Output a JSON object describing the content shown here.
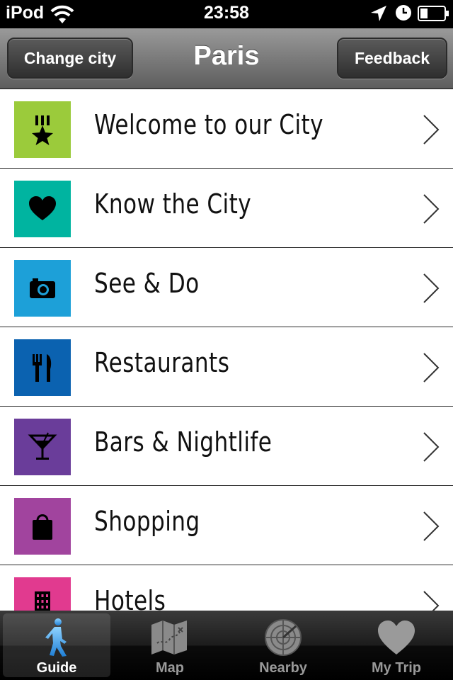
{
  "status_bar": {
    "carrier": "iPod",
    "time": "23:58"
  },
  "nav": {
    "left_button": "Change city",
    "title": "Paris",
    "right_button": "Feedback"
  },
  "menu": [
    {
      "label": "Welcome to our City",
      "icon": "medal-star-icon",
      "color": "#9bcb3b"
    },
    {
      "label": "Know the City",
      "icon": "heart-icon",
      "color": "#00b4a0"
    },
    {
      "label": "See & Do",
      "icon": "camera-icon",
      "color": "#1da0d8"
    },
    {
      "label": "Restaurants",
      "icon": "fork-knife-icon",
      "color": "#0b62b0"
    },
    {
      "label": "Bars & Nightlife",
      "icon": "cocktail-icon",
      "color": "#6a3d9a"
    },
    {
      "label": "Shopping",
      "icon": "shopping-bag-icon",
      "color": "#a1449e"
    },
    {
      "label": "Hotels",
      "icon": "building-icon",
      "color": "#e13a8f"
    }
  ],
  "tabs": [
    {
      "label": "Guide",
      "icon": "walking-person-icon",
      "active": true
    },
    {
      "label": "Map",
      "icon": "map-icon",
      "active": false
    },
    {
      "label": "Nearby",
      "icon": "radar-icon",
      "active": false
    },
    {
      "label": "My Trip",
      "icon": "heart-icon",
      "active": false
    }
  ]
}
